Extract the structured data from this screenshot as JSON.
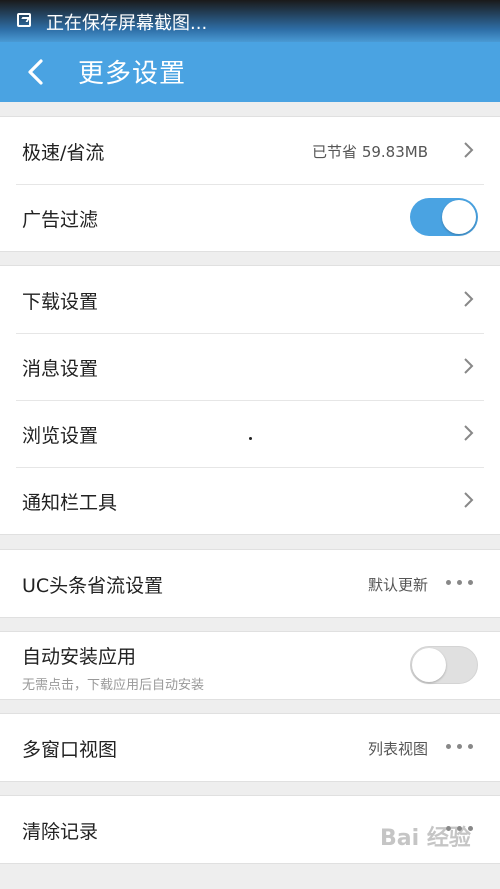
{
  "status_bar": {
    "text": "正在保存屏幕截图..."
  },
  "header": {
    "title": "更多设置"
  },
  "groups": [
    {
      "rows": [
        {
          "label": "极速/省流",
          "value": "已节省 59.83MB"
        },
        {
          "label": "广告过滤",
          "toggle": "on"
        }
      ]
    },
    {
      "rows": [
        {
          "label": "下载设置"
        },
        {
          "label": "消息设置"
        },
        {
          "label": "浏览设置"
        },
        {
          "label": "通知栏工具"
        }
      ]
    },
    {
      "rows": [
        {
          "label": "UC头条省流设置",
          "value": "默认更新"
        }
      ]
    },
    {
      "rows": [
        {
          "label": "自动安装应用",
          "sublabel": "无需点击，下载应用后自动安装",
          "toggle": "off"
        }
      ]
    },
    {
      "rows": [
        {
          "label": "多窗口视图",
          "value": "列表视图"
        }
      ]
    },
    {
      "rows": [
        {
          "label": "清除记录"
        }
      ]
    }
  ],
  "watermark": "Bai 经验",
  "colors": {
    "accent": "#4aa3e2",
    "toggle_on": "#4aa3e2",
    "background": "#eeeeee"
  }
}
